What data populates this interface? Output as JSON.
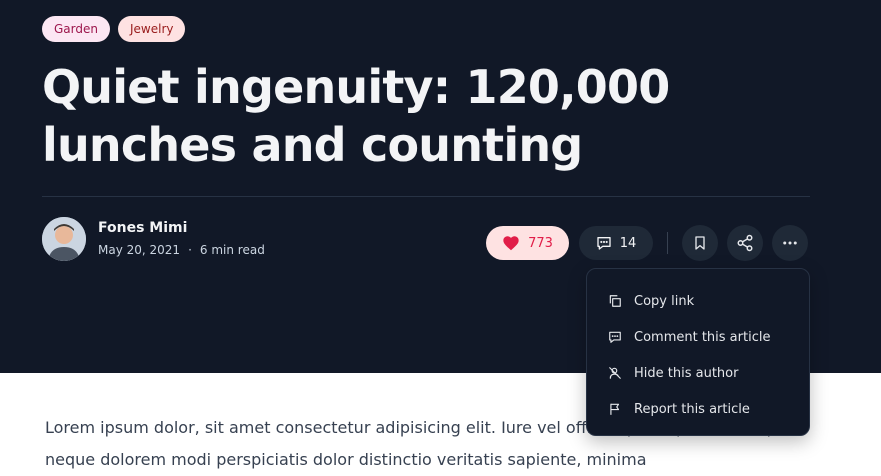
{
  "tags": [
    "Garden",
    "Jewelry"
  ],
  "title": "Quiet ingenuity: 120,000 lunches and counting",
  "author": {
    "name": "Fones Mimi",
    "date": "May 20, 2021",
    "separator": "·",
    "read_time": "6 min read"
  },
  "actions": {
    "likes": "773",
    "comments": "14"
  },
  "menu": {
    "items": [
      {
        "label": "Copy link",
        "icon": "copy-icon"
      },
      {
        "label": "Comment this article",
        "icon": "comment-icon"
      },
      {
        "label": "Hide this author",
        "icon": "hide-author-icon"
      },
      {
        "label": "Report this article",
        "icon": "flag-icon"
      }
    ]
  },
  "article": {
    "body": "Lorem ipsum dolor, sit amet consectetur adipisicing elit. Iure vel officiis ipsum placeat itaque neque dolorem modi perspiciatis dolor distinctio veritatis sapiente, minima"
  },
  "colors": {
    "hero_bg": "#111827",
    "like_bg": "#fee2e2",
    "like_accent": "#e11d48"
  }
}
